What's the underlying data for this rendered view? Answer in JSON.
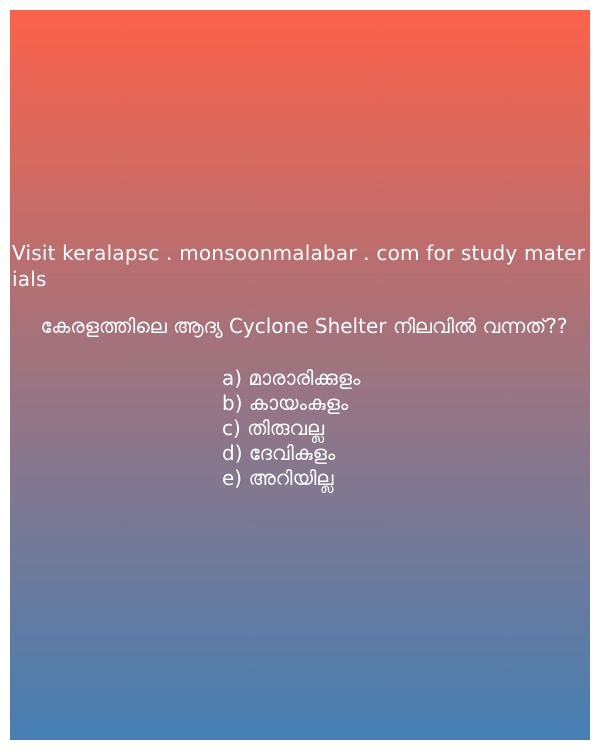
{
  "promo_text": "Visit keralapsc . monsoonmalabar . com for study materials",
  "question": "കേരളത്തിലെ ആദ്യ Cyclone Shelter നിലവിൽ വന്നത്??",
  "options": [
    "a) മാരാരിക്കുളം",
    "b) കായംകുളം",
    "c) തിരുവല്ല",
    "d) ദേവികുളം",
    "e) അറിയില്ല"
  ],
  "colors": {
    "gradient_top": "#fc624a",
    "gradient_mid": "#9c7480",
    "gradient_bottom": "#457fb3",
    "text": "#ffffff"
  }
}
